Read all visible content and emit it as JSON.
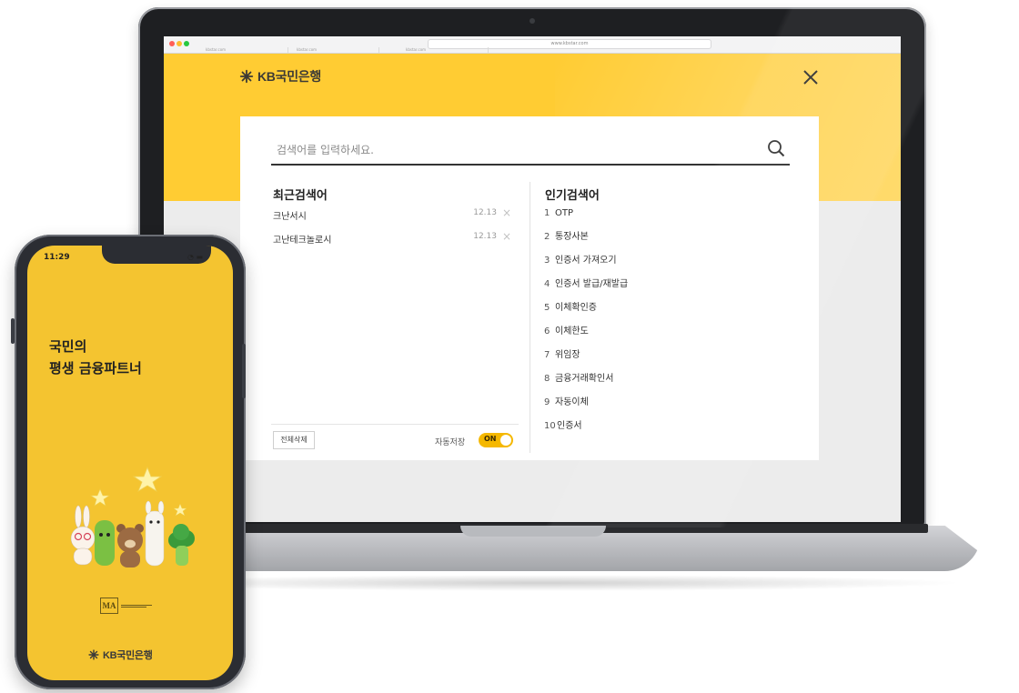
{
  "browser": {
    "url": "www.kbstar.com",
    "tabs": [
      "kbstar.com",
      "kbstar.com",
      "kbstar.com"
    ]
  },
  "header": {
    "logo_text": "KB국민은행",
    "close_label": "×"
  },
  "search": {
    "placeholder": "검색어를 입력하세요."
  },
  "recent": {
    "title": "최근검색어",
    "items": [
      {
        "keyword": "크난서시",
        "date": "12.13"
      },
      {
        "keyword": "고난테크놀로시",
        "date": "12.13"
      }
    ],
    "delete_all_label": "전체삭제",
    "autosave_label": "자동저장",
    "toggle_label": "ON"
  },
  "popular": {
    "title": "인기검색어",
    "items": [
      {
        "rank": "1",
        "keyword": "OTP"
      },
      {
        "rank": "2",
        "keyword": "통장사본"
      },
      {
        "rank": "3",
        "keyword": "인증서 가져오기"
      },
      {
        "rank": "4",
        "keyword": "인증서 발급/재발급"
      },
      {
        "rank": "5",
        "keyword": "이체확인증"
      },
      {
        "rank": "6",
        "keyword": "이체한도"
      },
      {
        "rank": "7",
        "keyword": "위임장"
      },
      {
        "rank": "8",
        "keyword": "금융거래확인서"
      },
      {
        "rank": "9",
        "keyword": "자동이체"
      },
      {
        "rank": "10",
        "keyword": "인증서"
      }
    ]
  },
  "phone": {
    "time": "11:29",
    "status_icons": "◔ ▬",
    "tagline_line1": "국민의",
    "tagline_line2": "평생 금융파트너",
    "ma_box": "MA",
    "bottom_logo_text": "KB국민은행"
  },
  "colors": {
    "kb_yellow": "#ffcc33",
    "phone_yellow": "#f4c430",
    "toggle_yellow": "#f5b800",
    "dark_text": "#222222"
  }
}
